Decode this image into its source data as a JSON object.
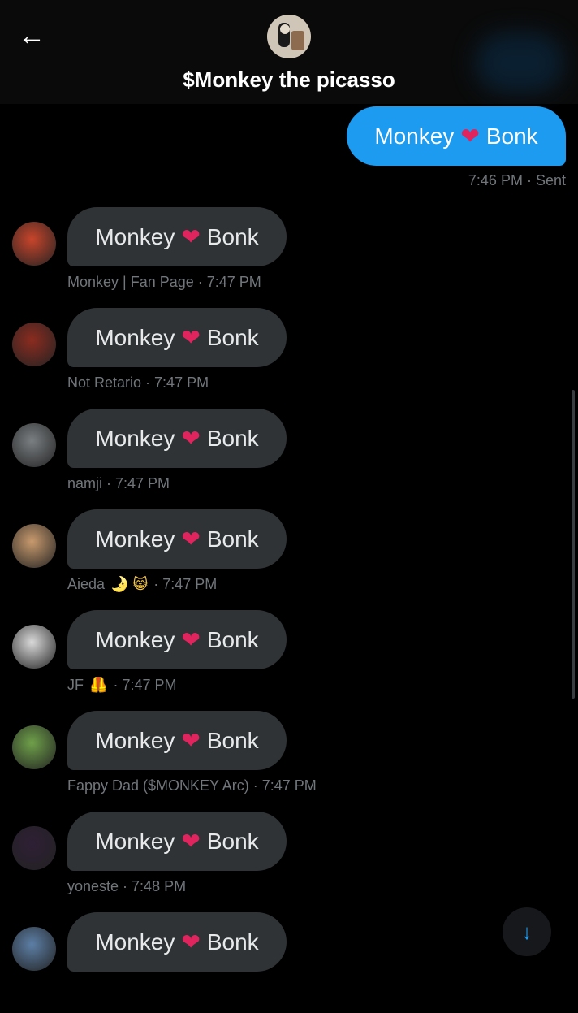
{
  "header": {
    "back_icon": "arrow-left-icon",
    "title": "$Monkey the picasso"
  },
  "sent": {
    "text_before": "Monkey",
    "heart": "❤",
    "text_after": "Bonk",
    "time": "7:46 PM",
    "status": "Sent"
  },
  "messages": [
    {
      "text_before": "Monkey",
      "heart": "❤",
      "text_after": "Bonk",
      "sender": "Monkey | Fan Page",
      "emoji": "",
      "time": "7:47 PM",
      "avatar_color": "#c8452b"
    },
    {
      "text_before": "Monkey",
      "heart": "❤",
      "text_after": "Bonk",
      "sender": "Not Retario",
      "emoji": "",
      "time": "7:47 PM",
      "avatar_color": "#8b2c20"
    },
    {
      "text_before": "Monkey",
      "heart": "❤",
      "text_after": "Bonk",
      "sender": "namji",
      "emoji": "",
      "time": "7:47 PM",
      "avatar_color": "#7a7f82"
    },
    {
      "text_before": "Monkey",
      "heart": "❤",
      "text_after": "Bonk",
      "sender": "Aieda",
      "emoji": "🌛 😸",
      "time": "7:47 PM",
      "avatar_color": "#c89a6e"
    },
    {
      "text_before": "Monkey",
      "heart": "❤",
      "text_after": "Bonk",
      "sender": "JF",
      "emoji": "🦺",
      "time": "7:47 PM",
      "avatar_color": "#d9d9d9"
    },
    {
      "text_before": "Monkey",
      "heart": "❤",
      "text_after": "Bonk",
      "sender": "Fappy Dad ($MONKEY Arc)",
      "emoji": "",
      "time": "7:47 PM",
      "avatar_color": "#6fa04a"
    },
    {
      "text_before": "Monkey",
      "heart": "❤",
      "text_after": "Bonk",
      "sender": "yoneste",
      "emoji": "",
      "time": "7:48 PM",
      "avatar_color": "#2e1f35"
    },
    {
      "text_before": "Monkey",
      "heart": "❤",
      "text_after": "Bonk",
      "sender": "",
      "emoji": "",
      "time": "",
      "avatar_color": "#5d7fa6"
    }
  ],
  "scroll_down_icon": "arrow-down-icon"
}
